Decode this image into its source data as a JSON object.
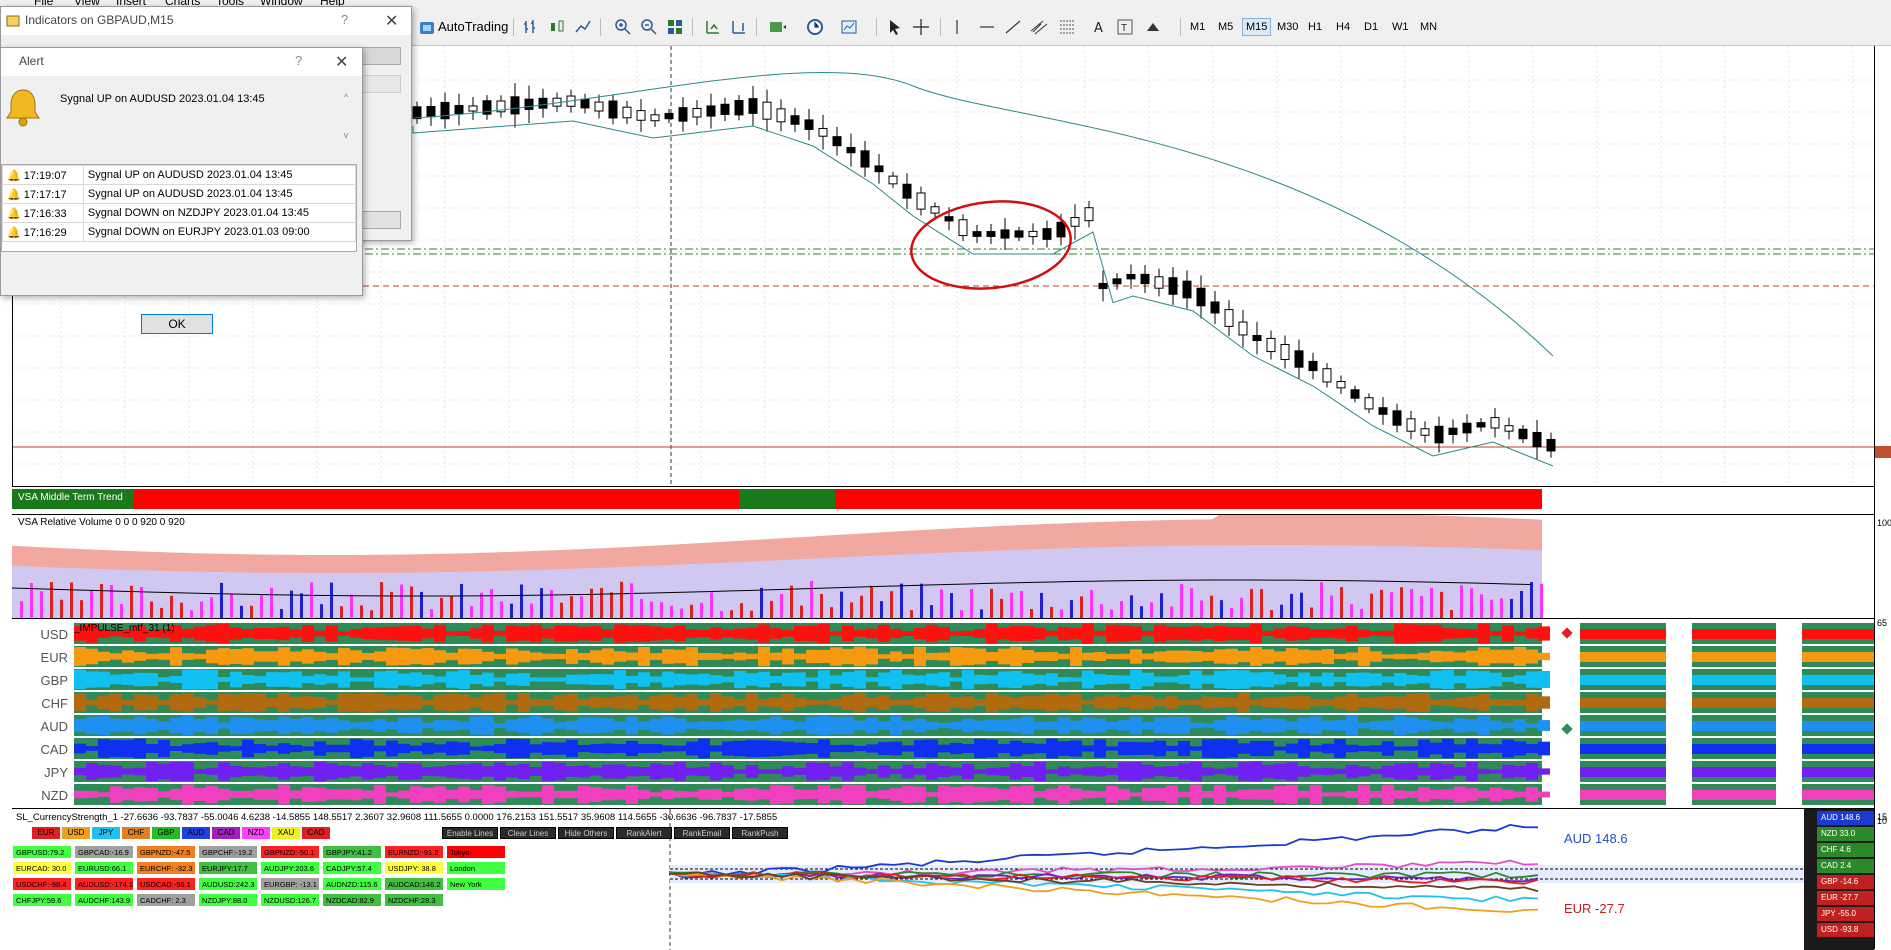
{
  "menubar": [
    "File",
    "View",
    "Insert",
    "Charts",
    "Tools",
    "Window",
    "Help"
  ],
  "toolbar": {
    "autotrading": "AutoTrading",
    "timeframes": [
      "M1",
      "M5",
      "M15",
      "M30",
      "H1",
      "H4",
      "D1",
      "W1",
      "MN"
    ],
    "active_timeframe": "M15"
  },
  "indicators_dialog": {
    "title": "Indicators on GBPAUD,M15",
    "help": "?",
    "close": "✕"
  },
  "alert_dialog": {
    "title": "Alert",
    "help": "?",
    "close": "✕",
    "message": "Sygnal  UP on AUDUSD 2023.01.04 13:45",
    "rows": [
      {
        "time": "17:19:07",
        "text": "Sygnal  UP on AUDUSD 2023.01.04 13:45"
      },
      {
        "time": "17:17:17",
        "text": "Sygnal  UP on AUDUSD 2023.01.04 13:45"
      },
      {
        "time": "17:16:33",
        "text": "Sygnal  DOWN on NZDJPY 2023.01.04 13:45"
      },
      {
        "time": "17:16:29",
        "text": "Sygnal  DOWN on EURJPY 2023.01.03 09:00"
      }
    ],
    "ok": "OK"
  },
  "subwindows": {
    "vsa_trend": "VSA Middle Term Trend",
    "vsa_volume": "VSA Relative Volume 0 0 0 920 0 920",
    "impulse": "_IMPULSE_mtf_31 (1)",
    "currency_strength": "SL_CurrencyStrength_1 -27.6636 -93.7837 -55.0046 4.6238 -14.5855 148.5517 2.3607 32.9608 111.5655 0.0000 176.2153 151.5517 35.9608 114.5655 -30.6636 -96.7837 -17.5855"
  },
  "impulse_currencies": [
    "USD",
    "EUR",
    "GBP",
    "CHF",
    "AUD",
    "CAD",
    "JPY",
    "NZD"
  ],
  "currency_buttons": [
    {
      "label": "EUR",
      "color": "#e02020"
    },
    {
      "label": "USD",
      "color": "#f0a020"
    },
    {
      "label": "JPY",
      "color": "#20c0f0"
    },
    {
      "label": "CHF",
      "color": "#e08020"
    },
    {
      "label": "GBP",
      "color": "#20c020"
    },
    {
      "label": "AUD",
      "color": "#2040e0"
    },
    {
      "label": "CAD",
      "color": "#a020c0"
    },
    {
      "label": "NZD",
      "color": "#ff40ff"
    },
    {
      "label": "XAU",
      "color": "#f0f020"
    },
    {
      "label": "CAD",
      "color": "#e02020"
    }
  ],
  "action_buttons": [
    "Enable Lines",
    "Clear Lines",
    "Hide Others",
    "RankAlert",
    "RankEmail",
    "RankPush"
  ],
  "pairs": [
    [
      {
        "t": "GBPUSD:79.2",
        "c": "#40ff40"
      },
      {
        "t": "GBPCAD:-16.9",
        "c": "#a0a0a0"
      },
      {
        "t": "GBPNZD:-47.5",
        "c": "#f08020"
      },
      {
        "t": "GBPCHF:-19.2",
        "c": "#a0a0a0"
      },
      {
        "t": "GBPNZD:-50.1",
        "c": "#ff2020"
      },
      {
        "t": "GBPJPY:41.2",
        "c": "#40c040"
      },
      {
        "t": "EURNZD:-91.2",
        "c": "#ff2020"
      },
      {
        "t": "Tokyo",
        "c": "#ff0000"
      }
    ],
    [
      {
        "t": "EURCAD: 30.0",
        "c": "#ffff40"
      },
      {
        "t": "EURUSD:66.1",
        "c": "#40ff40"
      },
      {
        "t": "EURCHF: -32.3",
        "c": "#f08020"
      },
      {
        "t": "EURJPY:17.7",
        "c": "#40c040"
      },
      {
        "t": "AUDJPY:203.6",
        "c": "#40ff40"
      },
      {
        "t": "CADJPY:57.4",
        "c": "#40ff40"
      },
      {
        "t": "USDJPY: 38.8",
        "c": "#ffff40"
      },
      {
        "t": "London",
        "c": "#40ff40"
      }
    ],
    [
      {
        "t": "USDCHF:-98.4",
        "c": "#ff2020"
      },
      {
        "t": "AUDUSD:-174.1",
        "c": "#ff2020"
      },
      {
        "t": "USDCAD:-96.1",
        "c": "#ff2020"
      },
      {
        "t": "AUDUSD:242.3",
        "c": "#40ff40"
      },
      {
        "t": "EURGBP: -13.1",
        "c": "#a0a0a0"
      },
      {
        "t": "AUDNZD:115.6",
        "c": "#40ff40"
      },
      {
        "t": "AUDCAD:146.2",
        "c": "#40c040"
      },
      {
        "t": "New York",
        "c": "#40ff40"
      }
    ],
    [
      {
        "t": "CHFJPY:59.6",
        "c": "#40ff40"
      },
      {
        "t": "AUDCHF:143.9",
        "c": "#40ff40"
      },
      {
        "t": "CADCHF: 2.3",
        "c": "#a0a0a0"
      },
      {
        "t": "NZDJPY:88.0",
        "c": "#40ff40"
      },
      {
        "t": "NZDUSD:126.7",
        "c": "#40ff40"
      },
      {
        "t": "NZDCAD:82.9",
        "c": "#40c040"
      },
      {
        "t": "NZDCHF:28.3",
        "c": "#40c040"
      }
    ]
  ],
  "big_labels": [
    {
      "t": "AUD  148.6",
      "c": "#2050c0"
    },
    {
      "t": "EUR  -27.7",
      "c": "#c02020"
    }
  ],
  "ranking": [
    {
      "t": "AUD  148.6",
      "c": "#1a3ad0"
    },
    {
      "t": "NZD  33.0",
      "c": "#2a8a2a"
    },
    {
      "t": "CHF  4.6",
      "c": "#2a8a2a"
    },
    {
      "t": "CAD  2.4",
      "c": "#2a8a2a"
    },
    {
      "t": "GBP  -14.6",
      "c": "#c02020"
    },
    {
      "t": "EUR  -27.7",
      "c": "#c02020"
    },
    {
      "t": "JPY  -55.0",
      "c": "#c02020"
    },
    {
      "t": "USD  -93.8",
      "c": "#c02020"
    }
  ],
  "axis_numbers": [
    "100",
    "65",
    "15",
    "10"
  ]
}
